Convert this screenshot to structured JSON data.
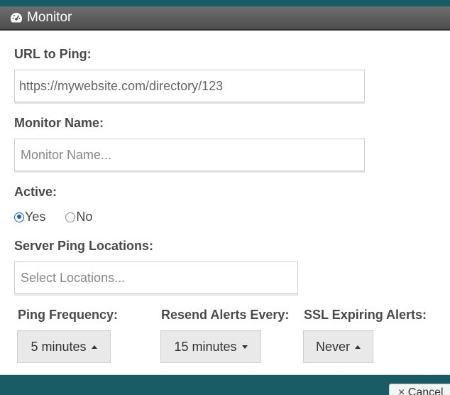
{
  "window": {
    "title": "Monitor",
    "icon": "dashboard-icon"
  },
  "form": {
    "url": {
      "label": "URL to Ping:",
      "value": "https://mywebsite.com/directory/123"
    },
    "name": {
      "label": "Monitor Name:",
      "placeholder": "Monitor Name..."
    },
    "active": {
      "label": "Active:",
      "options": [
        "Yes",
        "No"
      ],
      "selected": "Yes"
    },
    "locations": {
      "label": "Server Ping Locations:",
      "placeholder": "Select Locations..."
    },
    "ping_frequency": {
      "label": "Ping Frequency:",
      "value": "5 minutes"
    },
    "resend_alerts": {
      "label": "Resend Alerts Every:",
      "value": "15 minutes"
    },
    "ssl_alerts": {
      "label": "SSL Expiring Alerts:",
      "value": "Never"
    }
  },
  "footer": {
    "cancel_label": "× Cancel"
  },
  "colors": {
    "header_teal": "#1a5c66",
    "radio_accent": "#1a5ed1"
  }
}
